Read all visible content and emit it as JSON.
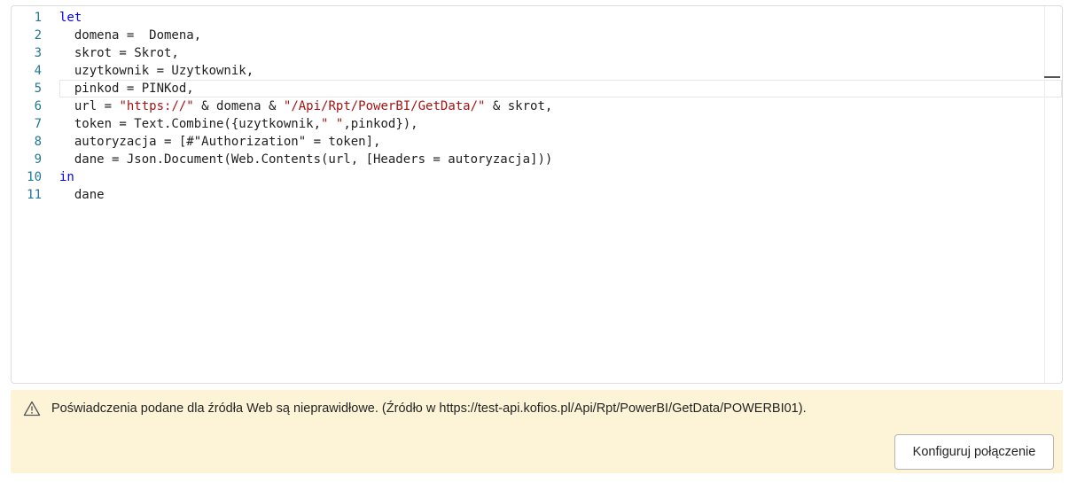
{
  "editor": {
    "lines": [
      {
        "n": "1",
        "segs": [
          {
            "t": "let",
            "c": "kw"
          }
        ]
      },
      {
        "n": "2",
        "segs": [
          {
            "t": "  domena =  Domena,",
            "c": ""
          }
        ]
      },
      {
        "n": "3",
        "segs": [
          {
            "t": "  skrot = Skrot,",
            "c": ""
          }
        ]
      },
      {
        "n": "4",
        "segs": [
          {
            "t": "  uzytkownik = Uzytkownik,",
            "c": ""
          }
        ]
      },
      {
        "n": "5",
        "segs": [
          {
            "t": "  pinkod = PINKod,",
            "c": ""
          }
        ]
      },
      {
        "n": "6",
        "segs": [
          {
            "t": "  url = ",
            "c": ""
          },
          {
            "t": "\"https://\"",
            "c": "str"
          },
          {
            "t": " & domena & ",
            "c": ""
          },
          {
            "t": "\"/Api/Rpt/PowerBI/GetData/\"",
            "c": "str"
          },
          {
            "t": " & skrot,",
            "c": ""
          }
        ]
      },
      {
        "n": "7",
        "segs": [
          {
            "t": "  token = Text.Combine({uzytkownik,",
            "c": ""
          },
          {
            "t": "\" \"",
            "c": "str"
          },
          {
            "t": ",pinkod}),",
            "c": ""
          }
        ]
      },
      {
        "n": "8",
        "segs": [
          {
            "t": "  autoryzacja = [#\"Authorization\" = token],",
            "c": ""
          }
        ]
      },
      {
        "n": "9",
        "segs": [
          {
            "t": "  dane = Json.Document(Web.Contents(url, [Headers = autoryzacja]))",
            "c": ""
          }
        ]
      },
      {
        "n": "10",
        "segs": [
          {
            "t": "in",
            "c": "kw"
          }
        ]
      },
      {
        "n": "11",
        "segs": [
          {
            "t": "  dane",
            "c": ""
          }
        ]
      }
    ],
    "current_line": "5"
  },
  "banner": {
    "icon": "warning-icon",
    "message": "Poświadczenia podane dla źródła Web są nieprawidłowe. (Źródło w https://test-api.kofios.pl/Api/Rpt/PowerBI/GetData/POWERBI01).",
    "button_label": "Konfiguruj połączenie"
  }
}
